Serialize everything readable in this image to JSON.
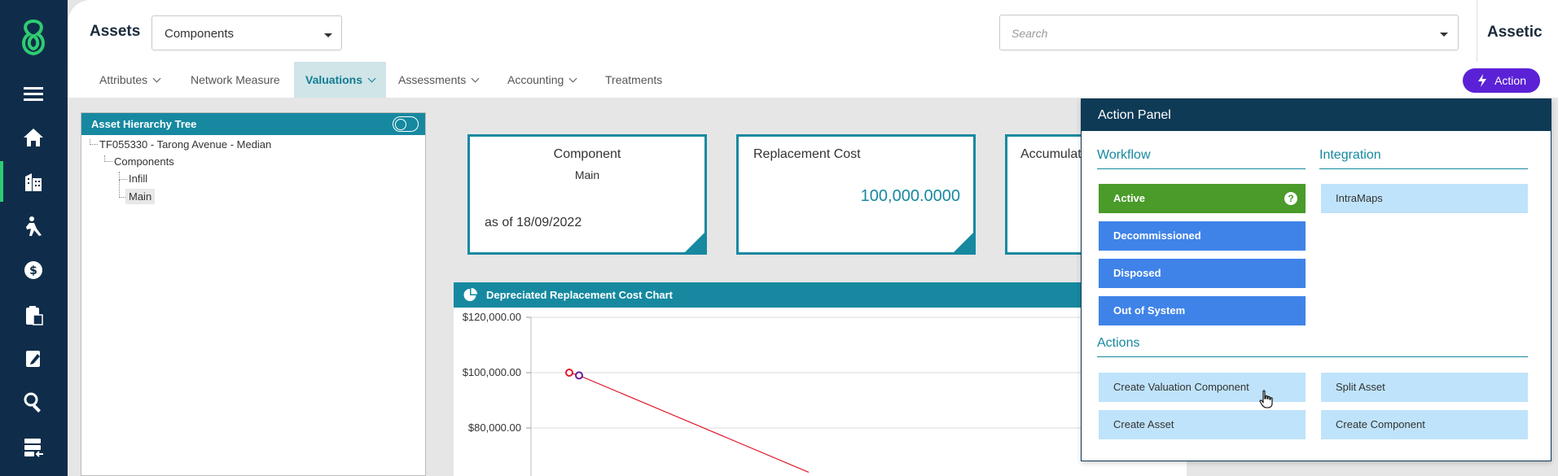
{
  "header": {
    "title": "Assets",
    "select_value": "Components",
    "search_placeholder": "Search",
    "brand": "Assetic"
  },
  "tabs": [
    {
      "label": "Attributes"
    },
    {
      "label": "Network Measure"
    },
    {
      "label": "Valuations"
    },
    {
      "label": "Assessments"
    },
    {
      "label": "Accounting"
    },
    {
      "label": "Treatments"
    }
  ],
  "action_button": "Action",
  "tree": {
    "title": "Asset Hierarchy Tree",
    "items": [
      {
        "label": "TF055330 - Tarong Avenue - Median"
      },
      {
        "label": "Components"
      },
      {
        "label": "Infill"
      },
      {
        "label": "Main"
      }
    ]
  },
  "cards": [
    {
      "title": "Component",
      "subtitle": "Main",
      "footer": "as of 18/09/2022"
    },
    {
      "title": "Replacement Cost",
      "value": "100,000.0000"
    },
    {
      "title": "Accumulat"
    }
  ],
  "chart": {
    "title": "Depreciated Replacement Cost Chart",
    "y_ticks": [
      "$120,000.00",
      "$100,000.00",
      "$80,000.00"
    ]
  },
  "chart_data": {
    "type": "line",
    "title": "Depreciated Replacement Cost Chart",
    "ylim": [
      60000,
      120000
    ],
    "y_ticks": [
      120000,
      100000,
      80000
    ],
    "series": [
      {
        "color": "#e0192c",
        "points": [
          {
            "y": 100000
          },
          {
            "y": 99000
          },
          {
            "y": 64000
          }
        ]
      }
    ]
  },
  "action_panel": {
    "title": "Action Panel",
    "workflow_label": "Workflow",
    "integration_label": "Integration",
    "actions_label": "Actions",
    "workflow": [
      "Active",
      "Decommissioned",
      "Disposed",
      "Out of System"
    ],
    "help_glyph": "?",
    "integration": [
      "IntraMaps"
    ],
    "actions": [
      "Create Valuation Component",
      "Split Asset",
      "Create Asset",
      "Create Component"
    ]
  },
  "colors": {
    "rail": "#0f2d4a",
    "teal": "#1689a0",
    "action_purple": "#5b21d6",
    "active_green": "#4a9b2a",
    "workflow_blue": "#3f83e8",
    "light_blue": "#bfe3fa"
  },
  "icons": [
    "logo-icon",
    "menu-icon",
    "home-icon",
    "building-icon",
    "worker-icon",
    "money-icon",
    "clipboard-calc-icon",
    "edit-icon",
    "search-icon",
    "database-icon"
  ]
}
